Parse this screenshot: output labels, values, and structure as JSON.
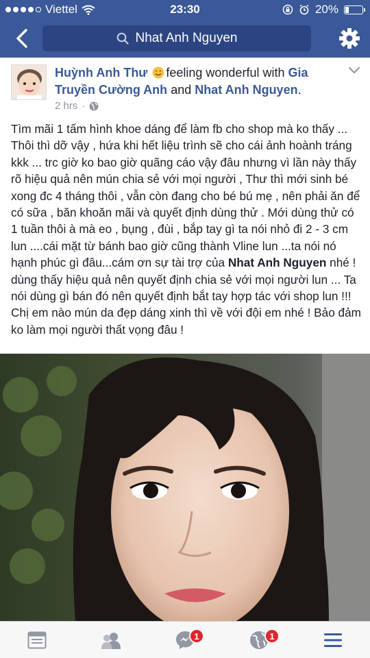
{
  "status_bar": {
    "carrier": "Viettel",
    "time": "23:30",
    "battery": "20%",
    "battery_level": 0.2,
    "signal_bars": 4,
    "icons": [
      "wifi-icon",
      "rotation-lock-icon",
      "alarm-icon",
      "battery-icon"
    ]
  },
  "nav": {
    "back_icon": "back-arrow-icon",
    "search_icon": "search-icon",
    "search_text": "Nhat Anh Nguyen",
    "settings_icon": "gear-icon"
  },
  "post": {
    "author": "Huỳnh Anh Thư",
    "feeling": "feeling wonderful with",
    "tagged_1": "Gia Truyền Cường Anh",
    "and": "and",
    "tagged_2": "Nhat Anh Nguyen",
    "period": ".",
    "time": "2 hrs",
    "separator": "·",
    "privacy_icon": "globe-icon",
    "text_part1": "Tìm mãi 1 tấm hình khoe dáng để làm fb cho shop mà ko thấy ... Thôi thì dỡ vậy , hứa khi hết liệu trình sẽ cho cái ảnh hoành tráng kkk ... trc giờ ko bao giờ quãng cáo vậy đâu nhưng vì lần này thấy rõ hiệu quả nên mún chia sẻ với mọi người , Thư thì mới sinh bé xong đc 4 tháng thôi , vẫn còn đang cho bé bú mẹ , nên phải ăn để có sữa , băn khoăn mãi và quyết định dùng thử . Mới dùng thử có 1 tuần thôi à mà eo , bụng , đùi , bắp tay gì ta nói nhỏ đi 2 - 3 cm lun ....cái mặt từ bánh bao giờ cũng thành Vline lun ...ta nói nó hạnh phúc gì đâu...cám ơn sự tài trợ của ",
    "text_tag": "Nhat Anh Nguyen",
    "text_part2": " nhé ! dùng thấy hiệu quả nên quyết định chia sẻ với mọi người lun ... Ta nói dùng gì bán đó nên quyết định bắt tay hợp tác với shop lun !!! Chị em nào mún da đẹp dáng xinh thì về với đội em nhé ! Bảo đảm ko làm mọi người thất vọng đâu !"
  },
  "tab_bar": {
    "tabs": [
      {
        "icon": "news-feed-icon",
        "badge": ""
      },
      {
        "icon": "friends-icon",
        "badge": ""
      },
      {
        "icon": "messenger-icon",
        "badge": "1"
      },
      {
        "icon": "notifications-globe-icon",
        "badge": "1"
      },
      {
        "icon": "menu-icon",
        "badge": ""
      }
    ]
  },
  "colors": {
    "brand": "#3b5998",
    "badge": "#e0262b"
  }
}
